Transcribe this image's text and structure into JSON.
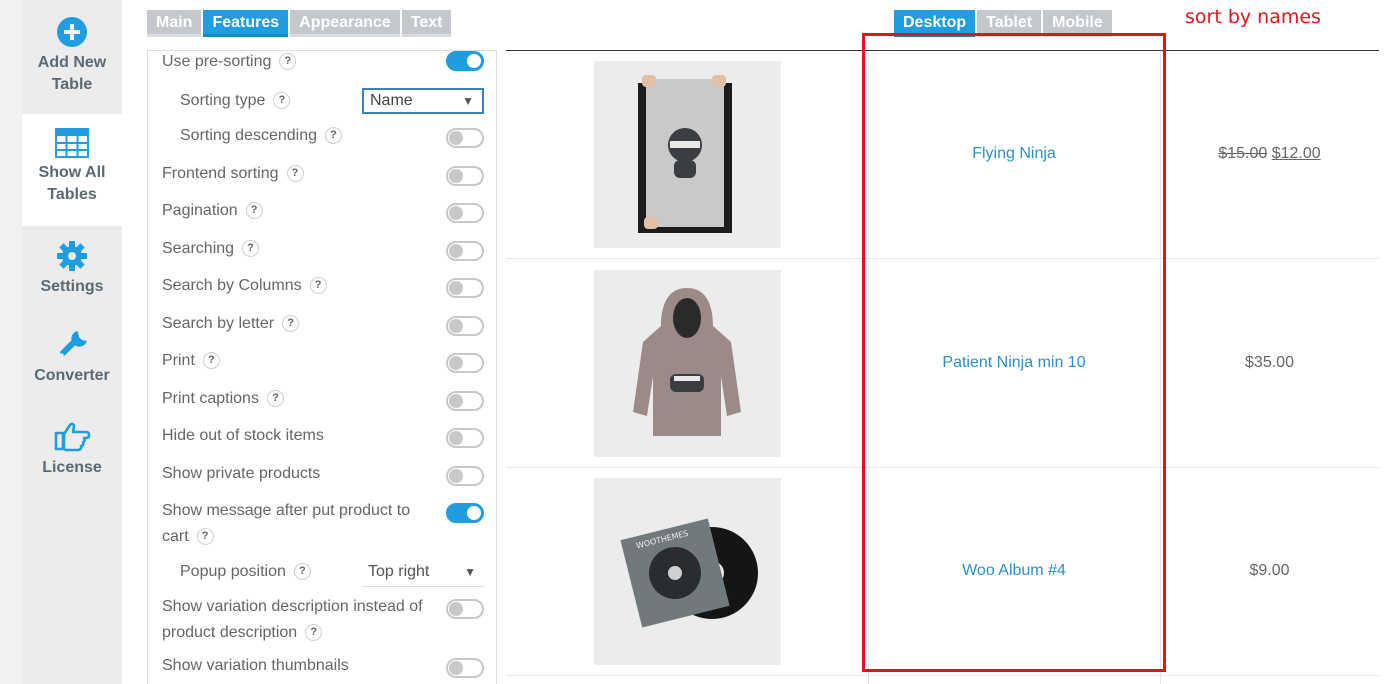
{
  "sidebar": {
    "items": [
      {
        "label": "Add New Table",
        "line1": "Add New",
        "line2": "Table"
      },
      {
        "label": "Show All Tables",
        "line1": "Show All",
        "line2": "Tables"
      },
      {
        "label": "Settings"
      },
      {
        "label": "Converter"
      },
      {
        "label": "License"
      }
    ],
    "icon_color": "#1e9ee0"
  },
  "tabs": [
    "Main",
    "Features",
    "Appearance",
    "Text"
  ],
  "active_tab": "Features",
  "device_tabs": [
    "Desktop",
    "Tablet",
    "Mobile"
  ],
  "active_device": "Desktop",
  "settings": [
    {
      "label": "Use pre-sorting",
      "on": true
    },
    {
      "label": "Sorting type",
      "select": "Name"
    },
    {
      "label": "Sorting descending",
      "on": false
    },
    {
      "label": "Frontend sorting",
      "on": false
    },
    {
      "label": "Pagination",
      "on": false
    },
    {
      "label": "Searching",
      "on": false
    },
    {
      "label": "Search by Columns",
      "on": false
    },
    {
      "label": "Search by letter",
      "on": false
    },
    {
      "label": "Print",
      "on": false
    },
    {
      "label": "Print captions",
      "on": false
    },
    {
      "label": "Hide out of stock items",
      "on": false
    },
    {
      "label": "Show private products",
      "on": false
    },
    {
      "label": "Show message after put product to",
      "label_cont": "cart",
      "on": true
    },
    {
      "label": "Popup position",
      "select": "Top right"
    },
    {
      "label": "Show variation description instead of",
      "label_cont": "product description",
      "on": false
    },
    {
      "label": "Show variation thumbnails",
      "on": false
    }
  ],
  "help_glyph": "?",
  "products": [
    {
      "name": "Flying Ninja",
      "old_price": "$15.00",
      "price": "$12.00"
    },
    {
      "name": "Patient Ninja min 10",
      "price": "$35.00"
    },
    {
      "name": "Woo Album #4",
      "price": "$9.00"
    }
  ],
  "album_cover_text": "WOOTHEMES",
  "annotation": {
    "text": "sort by names",
    "color": "#e0141b"
  },
  "accent": "#1e9ee0"
}
